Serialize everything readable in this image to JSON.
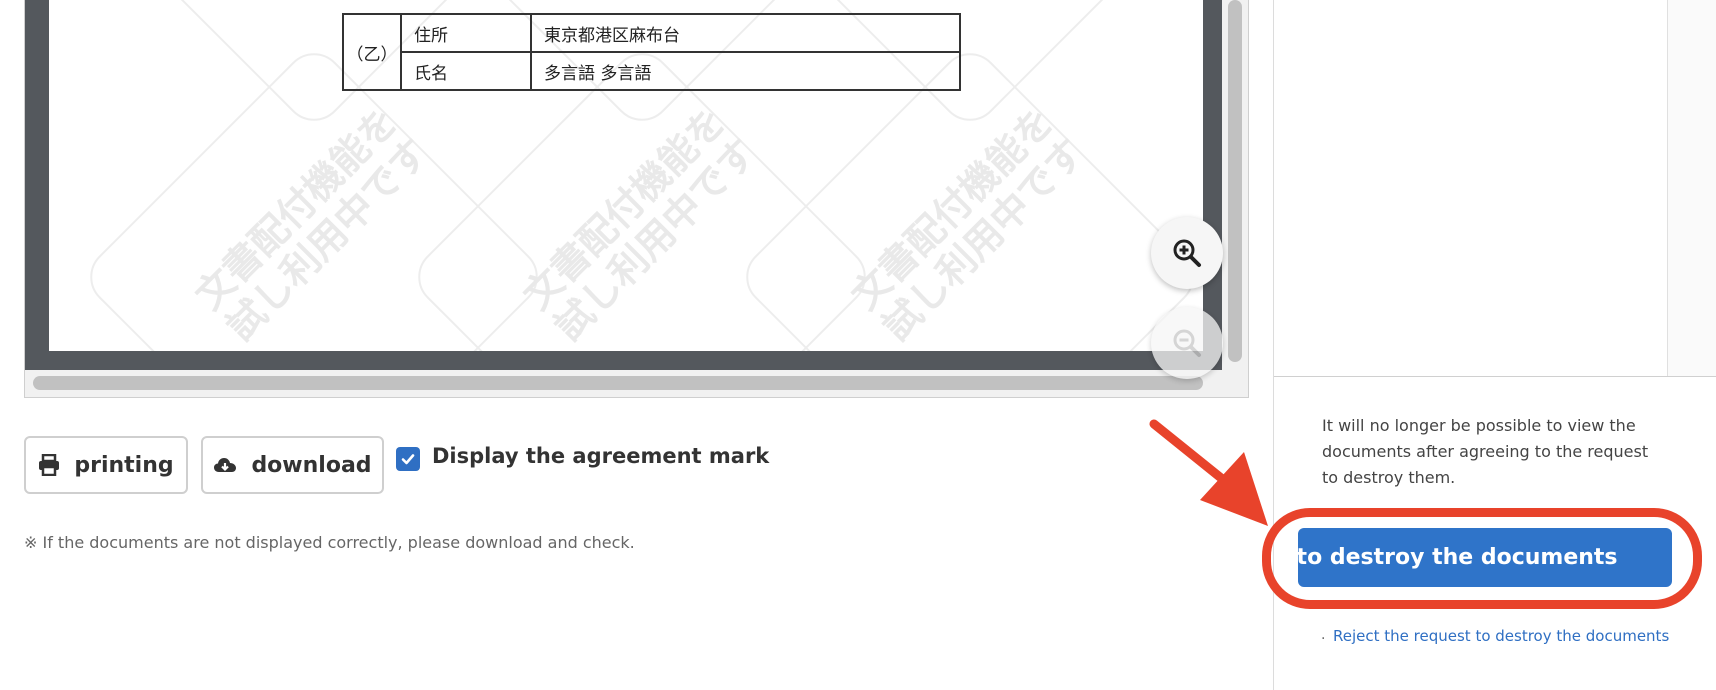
{
  "document": {
    "party_label": "（乙）",
    "rows": [
      {
        "label": "住所",
        "value": "東京都港区麻布台"
      },
      {
        "label": "氏名",
        "value": "多言語  多言語"
      }
    ],
    "watermark_line1": "文書配付機能を",
    "watermark_line2": "試し利用中です"
  },
  "viewer": {
    "zoom_in_icon": "zoom-in-icon",
    "zoom_out_icon": "zoom-out-icon"
  },
  "toolbar": {
    "print_label": "printing",
    "download_label": "download",
    "agreement_mark_label": "Display the agreement mark",
    "agreement_mark_checked": true
  },
  "note": "※ If the documents are not displayed correctly, please download and check.",
  "right_panel": {
    "info_text": "It will no longer be possible to view the documents after agreeing to the request to destroy them.",
    "agree_button_label": "Agree to the request to destroy the documents",
    "reject_prefix": ".",
    "reject_link": "Reject the request to destroy the documents"
  },
  "colors": {
    "primary": "#2f74c9",
    "highlight": "#e8432b"
  }
}
